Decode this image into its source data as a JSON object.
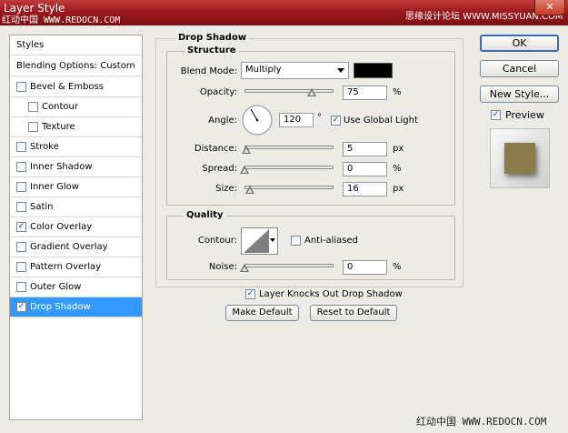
{
  "window": {
    "title": "Layer Style",
    "close_label": "✕",
    "watermark_left": "红动中国 WWW.REDOCN.COM",
    "watermark_right": "思缘设计论坛 WWW.MISSYUAN.COM",
    "watermark_bottom": "红动中国 WWW.REDOCN.COM"
  },
  "sidebar": {
    "header": "Styles",
    "blending": "Blending Options: Custom",
    "items": [
      {
        "label": "Bevel & Emboss",
        "checked": false,
        "sub": false
      },
      {
        "label": "Contour",
        "checked": false,
        "sub": true
      },
      {
        "label": "Texture",
        "checked": false,
        "sub": true
      },
      {
        "label": "Stroke",
        "checked": false,
        "sub": false
      },
      {
        "label": "Inner Shadow",
        "checked": false,
        "sub": false
      },
      {
        "label": "Inner Glow",
        "checked": false,
        "sub": false
      },
      {
        "label": "Satin",
        "checked": false,
        "sub": false
      },
      {
        "label": "Color Overlay",
        "checked": true,
        "sub": false
      },
      {
        "label": "Gradient Overlay",
        "checked": false,
        "sub": false
      },
      {
        "label": "Pattern Overlay",
        "checked": false,
        "sub": false
      },
      {
        "label": "Outer Glow",
        "checked": false,
        "sub": false
      },
      {
        "label": "Drop Shadow",
        "checked": true,
        "sub": false,
        "selected": true
      }
    ]
  },
  "main": {
    "section_title": "Drop Shadow",
    "structure": {
      "title": "Structure",
      "blend_mode_label": "Blend Mode:",
      "blend_mode_value": "Multiply",
      "shadow_color": "#000000",
      "opacity_label": "Opacity:",
      "opacity_value": "75",
      "opacity_unit": "%",
      "opacity_fraction": 0.75,
      "angle_label": "Angle:",
      "angle_value": "120",
      "angle_unit": "°",
      "angle_degrees": 120,
      "use_global_light_label": "Use Global Light",
      "use_global_light_checked": true,
      "distance_label": "Distance:",
      "distance_value": "5",
      "distance_unit": "px",
      "distance_fraction": 0.02,
      "spread_label": "Spread:",
      "spread_value": "0",
      "spread_unit": "%",
      "spread_fraction": 0.0,
      "size_label": "Size:",
      "size_value": "16",
      "size_unit": "px",
      "size_fraction": 0.065
    },
    "quality": {
      "title": "Quality",
      "contour_label": "Contour:",
      "anti_aliased_label": "Anti-aliased",
      "anti_aliased_checked": false,
      "noise_label": "Noise:",
      "noise_value": "0",
      "noise_unit": "%",
      "noise_fraction": 0.0
    },
    "knockout_label": "Layer Knocks Out Drop Shadow",
    "knockout_checked": true,
    "make_default_label": "Make Default",
    "reset_default_label": "Reset to Default"
  },
  "actions": {
    "ok_label": "OK",
    "cancel_label": "Cancel",
    "new_style_label": "New Style...",
    "preview_label": "Preview",
    "preview_checked": true,
    "preview_swatch_color": "#8b7d4a"
  }
}
